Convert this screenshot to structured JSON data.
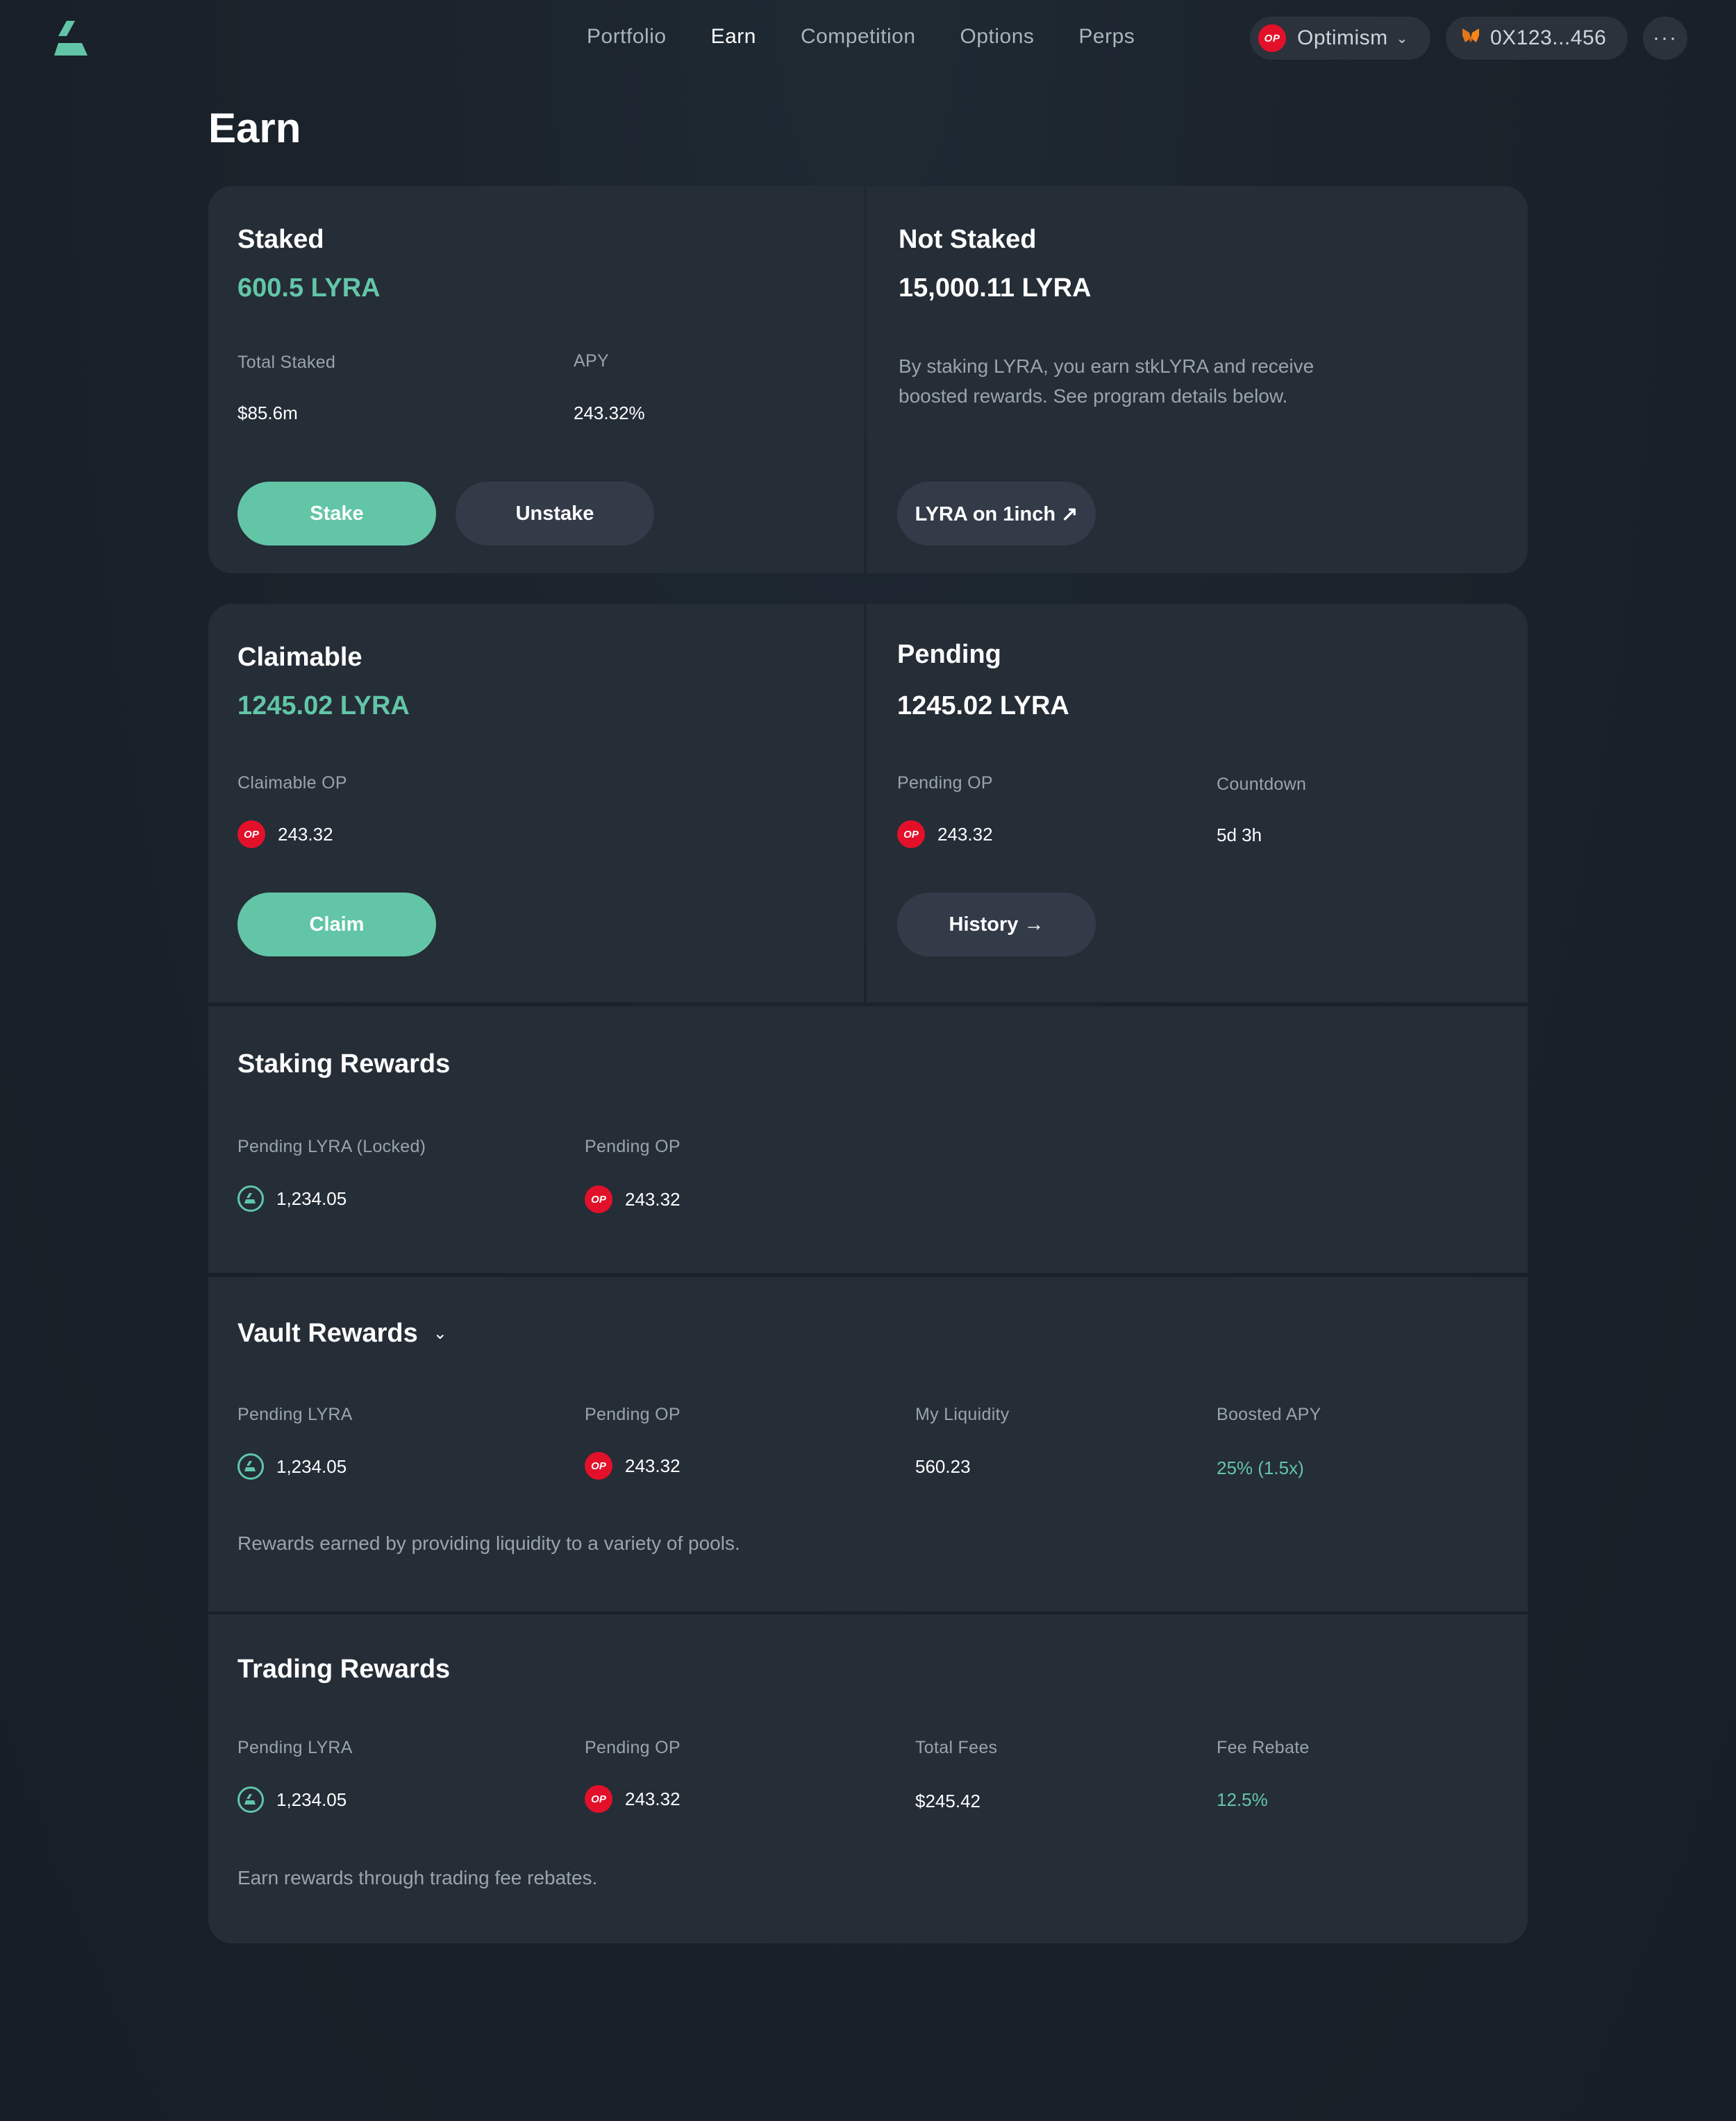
{
  "nav": {
    "links": [
      {
        "label": "Portfolio",
        "active": false
      },
      {
        "label": "Earn",
        "active": true
      },
      {
        "label": "Competition",
        "active": false
      },
      {
        "label": "Options",
        "active": false
      },
      {
        "label": "Perps",
        "active": false
      }
    ],
    "network": {
      "badge": "OP",
      "label": "Optimism"
    },
    "wallet": {
      "label": "0X123...456"
    }
  },
  "page_title": "Earn",
  "staked": {
    "title": "Staked",
    "amount": "600.5 LYRA",
    "total_staked_label": "Total Staked",
    "total_staked_value": "$85.6m",
    "apy_label": "APY",
    "apy_value": "243.32%",
    "stake_button": "Stake",
    "unstake_button": "Unstake"
  },
  "not_staked": {
    "title": "Not Staked",
    "amount": "15,000.11 LYRA",
    "description_line1": "By staking LYRA, you earn stkLYRA and receive",
    "description_line2": "boosted rewards. See program details below.",
    "button": "LYRA on 1inch ↗"
  },
  "claimable": {
    "title": "Claimable",
    "amount": "1245.02 LYRA",
    "op_label": "Claimable OP",
    "op_value": "243.32",
    "button": "Claim"
  },
  "pending": {
    "title": "Pending",
    "amount": "1245.02 LYRA",
    "op_label": "Pending OP",
    "op_value": "243.32",
    "countdown_label": "Countdown",
    "countdown_value": "5d 3h",
    "button": "History →"
  },
  "staking_rewards": {
    "title": "Staking Rewards",
    "lyra_label": "Pending LYRA (Locked)",
    "lyra_value": "1,234.05",
    "op_label": "Pending OP",
    "op_value": "243.32"
  },
  "vault_rewards": {
    "title": "Vault Rewards",
    "lyra_label": "Pending LYRA",
    "lyra_value": "1,234.05",
    "op_label": "Pending OP",
    "op_value": "243.32",
    "liquidity_label": "My Liquidity",
    "liquidity_value": "560.23",
    "boosted_label": "Boosted APY",
    "boosted_value": "25% (1.5x)",
    "description": "Rewards earned by providing liquidity to a variety of pools."
  },
  "trading_rewards": {
    "title": "Trading Rewards",
    "lyra_label": "Pending LYRA",
    "lyra_value": "1,234.05",
    "op_label": "Pending OP",
    "op_value": "243.32",
    "fees_label": "Total Fees",
    "fees_value": "$245.42",
    "rebate_label": "Fee Rebate",
    "rebate_value": "12.5%",
    "description": "Earn rewards through trading fee rebates."
  },
  "colors": {
    "accent": "#62c6a6",
    "card": "#252d37",
    "op_red": "#e3102a",
    "secondary_button": "#333b48"
  }
}
